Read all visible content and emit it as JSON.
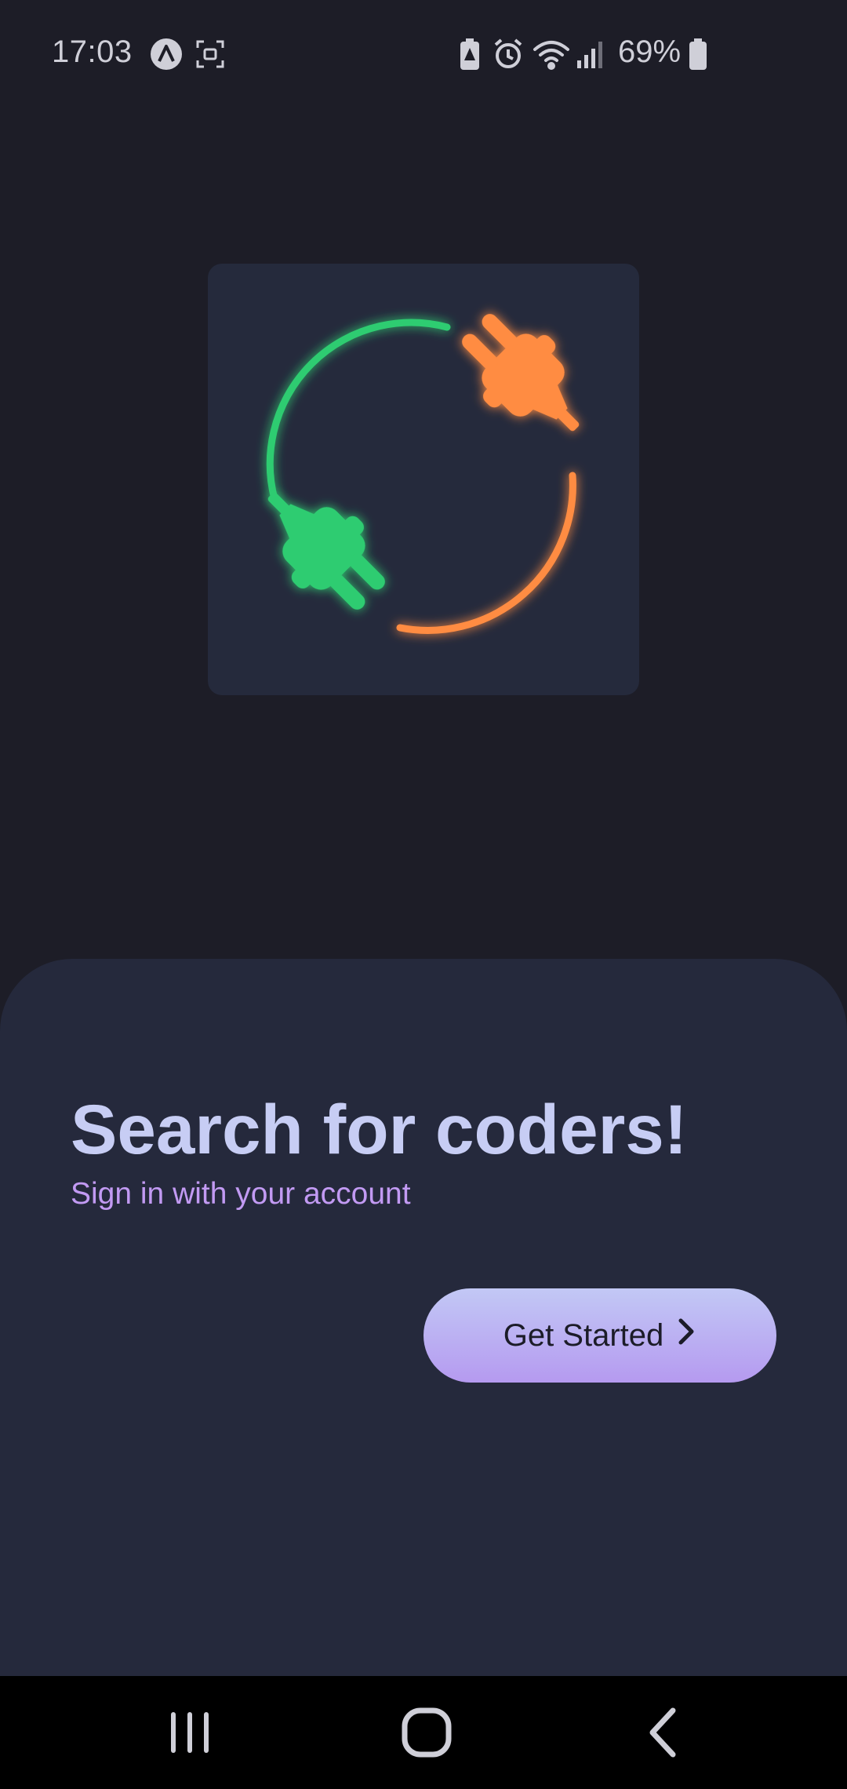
{
  "status_bar": {
    "time": "17:03",
    "icons": [
      "vpn-icon",
      "screen-capture-icon",
      "battery-saver-icon",
      "alarm-icon",
      "wifi-icon",
      "signal-icon",
      "battery-icon"
    ],
    "battery_percent": "69%"
  },
  "logo": {
    "icon": "plug-connection-icon",
    "colors": {
      "left_plug": "#2ecc71",
      "right_plug": "#ff8c42",
      "card": "#252a3c"
    }
  },
  "welcome": {
    "title": "Search for coders!",
    "subtitle": "Sign in with your account",
    "cta_label": "Get Started",
    "cta_icon": "chevron-right-icon"
  },
  "nav_bar": {
    "buttons": [
      "recent-apps-icon",
      "home-icon",
      "back-icon"
    ]
  },
  "colors": {
    "background": "#1d1d27",
    "sheet": "#25293c",
    "title": "#c7cdf4",
    "subtitle": "#c29af3",
    "button_gradient_top": "#c2c8f5",
    "button_gradient_bottom": "#b59af0"
  }
}
